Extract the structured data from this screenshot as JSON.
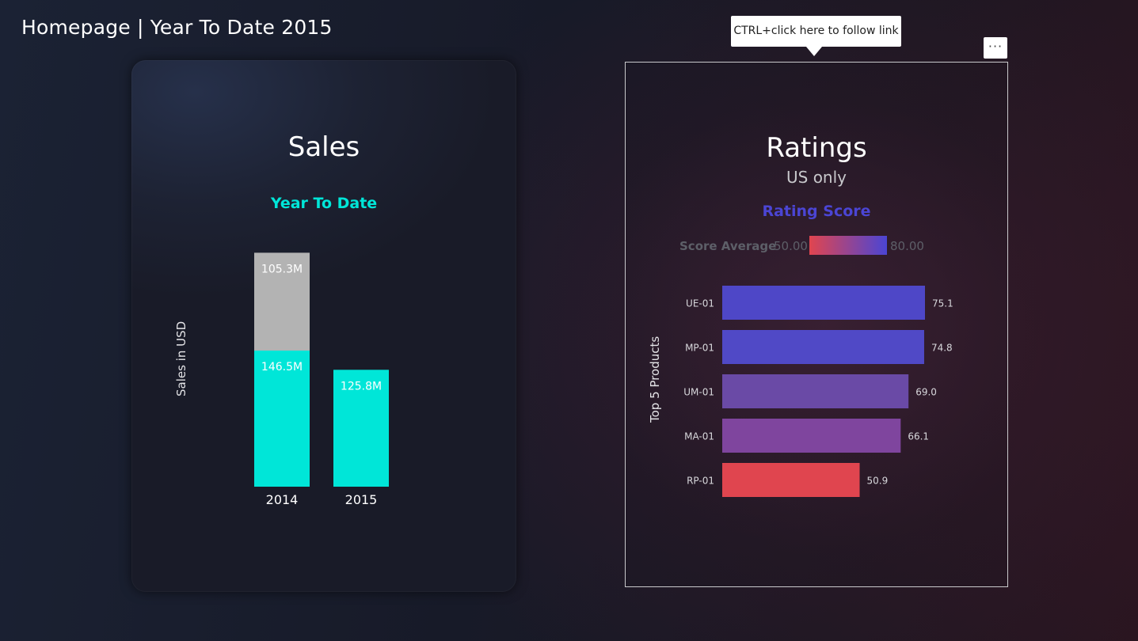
{
  "page": {
    "title": "Homepage | Year To Date 2015"
  },
  "tooltip": {
    "text": "CTRL+click here to follow link"
  },
  "more_options": {
    "label": "···"
  },
  "sales_card": {
    "title": "Sales",
    "subtitle": "Year To Date",
    "subtitle_color": "#00e6d8",
    "ylabel": "Sales in USD"
  },
  "ratings_card": {
    "title": "Ratings",
    "subtitle": "US only",
    "measure_title": "Rating Score",
    "measure_color": "#4b45d4",
    "legend": {
      "title": "Score Average",
      "min_label": "50.00",
      "max_label": "80.00",
      "min_color": "#e0454f",
      "max_color": "#4b45d4"
    },
    "ylabel": "Top 5 Products"
  },
  "chart_data": [
    {
      "type": "bar",
      "stacked": true,
      "categories": [
        "2014",
        "2015"
      ],
      "series": [
        {
          "values": [
            146.5,
            125.8
          ],
          "labels": [
            "146.5M",
            "125.8M"
          ],
          "color": "#00e6d8"
        },
        {
          "values": [
            105.3,
            0
          ],
          "labels": [
            "105.3M",
            ""
          ],
          "color": "#b3b3b3"
        }
      ],
      "title": "Sales",
      "ylabel": "Sales in USD"
    },
    {
      "type": "bar",
      "orientation": "horizontal",
      "categories": [
        "UE-01",
        "MP-01",
        "UM-01",
        "MA-01",
        "RP-01"
      ],
      "values": [
        75.1,
        74.8,
        69.0,
        66.1,
        50.9
      ],
      "labels": [
        "75.1",
        "74.8",
        "69.0",
        "66.1",
        "50.9"
      ],
      "colors": [
        "#4e47c7",
        "#5049c6",
        "#6a4aa6",
        "#7f459e",
        "#e0454f"
      ],
      "title": "Ratings",
      "ylabel": "Top 5 Products"
    }
  ]
}
